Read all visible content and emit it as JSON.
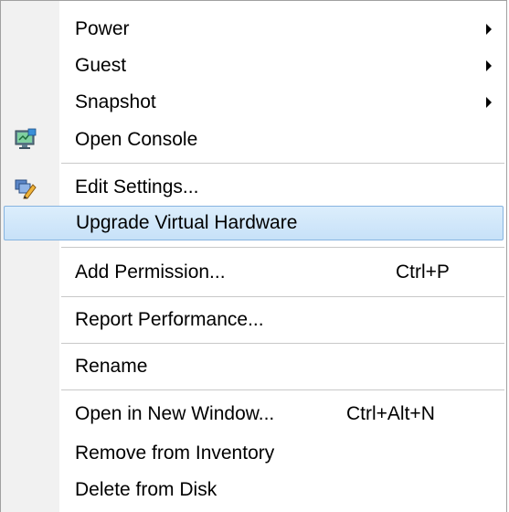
{
  "menu": {
    "items": [
      {
        "label": "Power",
        "has_submenu": true
      },
      {
        "label": "Guest",
        "has_submenu": true
      },
      {
        "label": "Snapshot",
        "has_submenu": true
      },
      {
        "label": "Open Console",
        "icon": "console-icon"
      },
      {
        "label": "Edit Settings...",
        "icon": "edit-settings-icon"
      },
      {
        "label": "Upgrade Virtual Hardware",
        "highlighted": true
      },
      {
        "label": "Add Permission...",
        "shortcut": "Ctrl+P"
      },
      {
        "label": "Report Performance..."
      },
      {
        "label": "Rename"
      },
      {
        "label": "Open in New Window...",
        "shortcut": "Ctrl+Alt+N"
      },
      {
        "label": "Remove from Inventory"
      },
      {
        "label": "Delete from Disk"
      }
    ]
  },
  "colors": {
    "highlight_bg": "#c7e1f8",
    "highlight_border": "#87b4e0",
    "gutter": "#f1f1f1"
  }
}
